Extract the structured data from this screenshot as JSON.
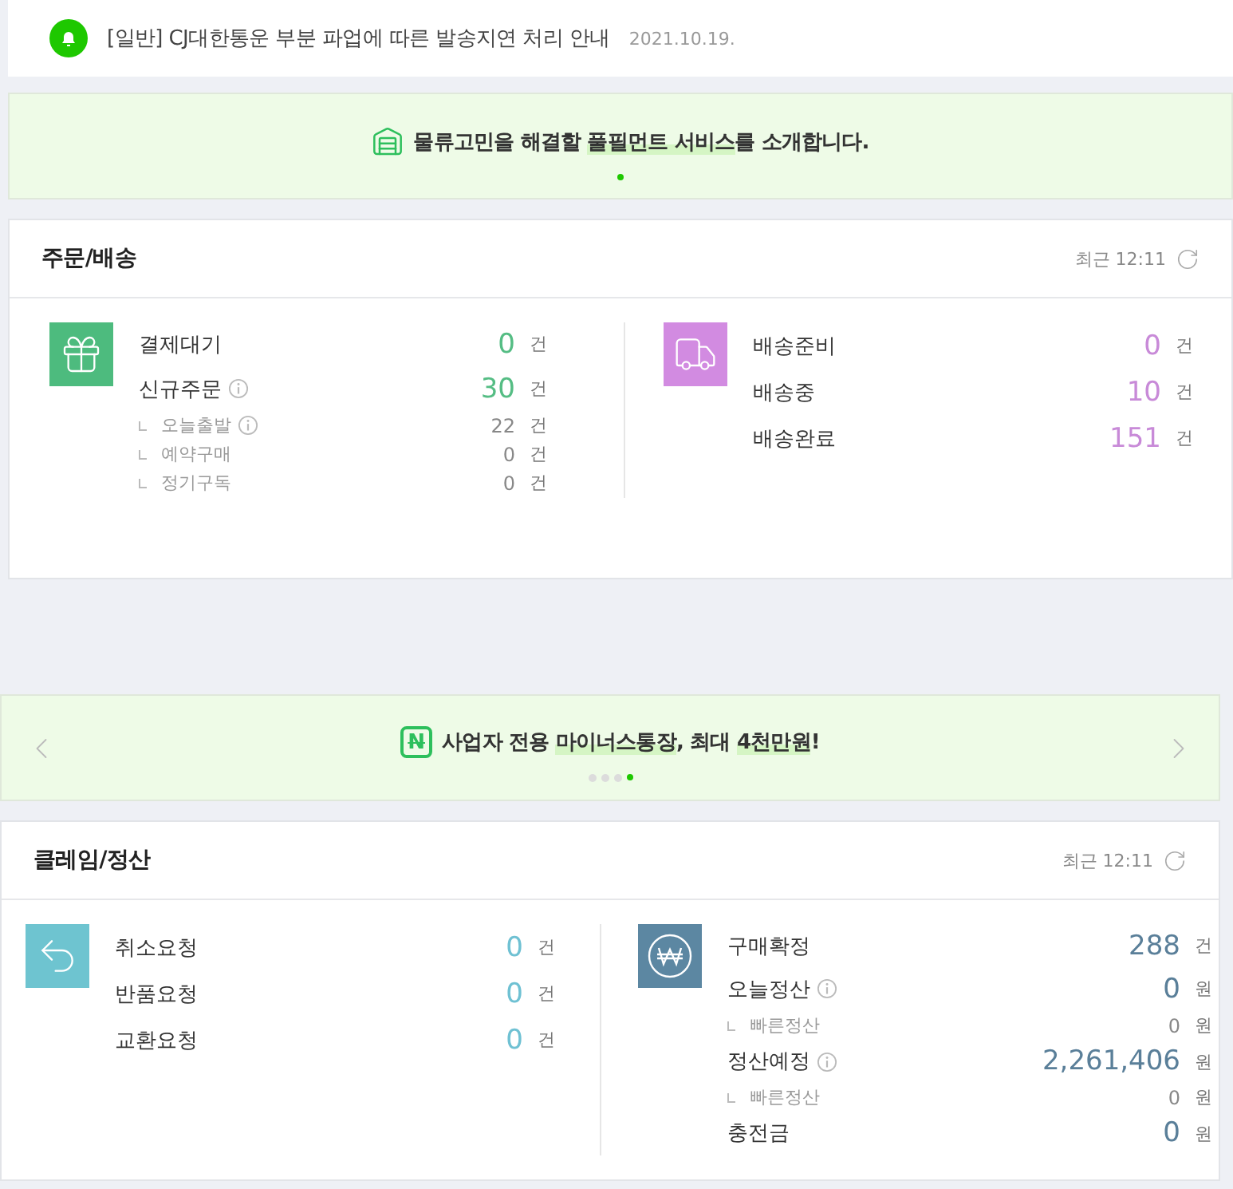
{
  "notice": {
    "text": "[일반] CJ대한통운 부분 파업에 따른 발송지연 처리 안내",
    "date": "2021.10.19."
  },
  "banners": [
    {
      "kind": "warehouse",
      "parts": [
        {
          "text": "물류고민을 해결할 ",
          "highlighted": false
        },
        {
          "text": "풀필먼트 서비스",
          "highlighted": true
        },
        {
          "text": "를 소개합니다.",
          "highlighted": false
        }
      ],
      "arrows": false,
      "dots": [
        {
          "selected": true
        }
      ]
    },
    {
      "kind": "badge",
      "badge": "N",
      "parts": [
        {
          "text": "사업자 전용 ",
          "highlighted": false
        },
        {
          "text": "마이너스통장",
          "highlighted": true
        },
        {
          "text": ", 최대 ",
          "highlighted": false
        },
        {
          "text": "4천만원",
          "highlighted": true
        },
        {
          "text": "!",
          "highlighted": false
        }
      ],
      "arrows": true,
      "dots": [
        {
          "selected": false
        },
        {
          "selected": false
        },
        {
          "selected": false
        },
        {
          "selected": true
        }
      ]
    }
  ],
  "sections": [
    {
      "title": "주문/배송",
      "updated": "최근 12:11",
      "groups": [
        {
          "kind": "order",
          "rows": [
            {
              "label": "결제대기",
              "info": false,
              "sub": false,
              "value": "0",
              "unit": "건"
            },
            {
              "label": "신규주문",
              "info": true,
              "sub": false,
              "value": "30",
              "unit": "건"
            },
            {
              "label": "오늘출발",
              "info": true,
              "sub": true,
              "value": "22",
              "unit": "건"
            },
            {
              "label": "예약구매",
              "info": false,
              "sub": true,
              "value": "0",
              "unit": "건"
            },
            {
              "label": "정기구독",
              "info": false,
              "sub": true,
              "value": "0",
              "unit": "건"
            }
          ]
        },
        {
          "kind": "delivery",
          "rows": [
            {
              "label": "배송준비",
              "info": false,
              "sub": false,
              "value": "0",
              "unit": "건"
            },
            {
              "label": "배송중",
              "info": false,
              "sub": false,
              "value": "10",
              "unit": "건"
            },
            {
              "label": "배송완료",
              "info": false,
              "sub": false,
              "value": "151",
              "unit": "건"
            }
          ]
        }
      ]
    },
    {
      "title": "클레임/정산",
      "updated": "최근 12:11",
      "groups": [
        {
          "kind": "claim",
          "rows": [
            {
              "label": "취소요청",
              "info": false,
              "sub": false,
              "value": "0",
              "unit": "건"
            },
            {
              "label": "반품요청",
              "info": false,
              "sub": false,
              "value": "0",
              "unit": "건"
            },
            {
              "label": "교환요청",
              "info": false,
              "sub": false,
              "value": "0",
              "unit": "건"
            }
          ]
        },
        {
          "kind": "settlement",
          "rows": [
            {
              "label": "구매확정",
              "info": false,
              "sub": false,
              "value": "288",
              "unit": "건"
            },
            {
              "label": "오늘정산",
              "info": true,
              "sub": false,
              "value": "0",
              "unit": "원"
            },
            {
              "label": "빠른정산",
              "info": false,
              "sub": true,
              "value": "0",
              "unit": "원"
            },
            {
              "label": "정산예정",
              "info": true,
              "sub": false,
              "value": "2,261,406",
              "unit": "원"
            },
            {
              "label": "빠른정산",
              "info": false,
              "sub": true,
              "value": "0",
              "unit": "원"
            },
            {
              "label": "충전금",
              "info": false,
              "sub": false,
              "value": "0",
              "unit": "원"
            }
          ]
        }
      ]
    }
  ]
}
